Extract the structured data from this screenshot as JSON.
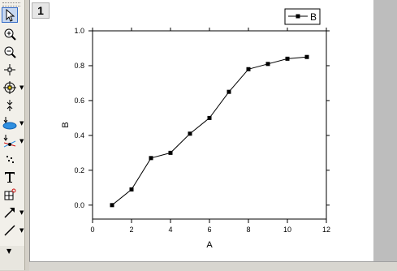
{
  "toolbar": {
    "tools": [
      {
        "name": "pointer-tool",
        "icon": "cursor-arrow-icon"
      },
      {
        "name": "zoom-in-tool",
        "icon": "zoom-in-icon"
      },
      {
        "name": "zoom-out-tool",
        "icon": "zoom-out-icon"
      },
      {
        "name": "screen-reader-tool",
        "icon": "crosshair-icon"
      },
      {
        "name": "data-reader-tool",
        "icon": "target-icon"
      },
      {
        "name": "data-selector-tool",
        "icon": "data-selector-icon"
      },
      {
        "name": "draw-data-tool",
        "icon": "draw-data-icon"
      },
      {
        "name": "mask-points-tool",
        "icon": "mask-points-icon"
      },
      {
        "name": "region-selector-tool",
        "icon": "scatter-dots-icon"
      },
      {
        "name": "text-tool",
        "icon": "text-T-icon"
      },
      {
        "name": "add-object-tool",
        "icon": "grid-plus-icon"
      },
      {
        "name": "arrow-tool",
        "icon": "arrow-icon"
      },
      {
        "name": "line-tool",
        "icon": "line-icon"
      }
    ]
  },
  "window": {
    "page_number": "1"
  },
  "chart_data": {
    "type": "line",
    "xlabel": "A",
    "ylabel": "B",
    "xlim": [
      0,
      12
    ],
    "ylim": [
      -0.08,
      1.0
    ],
    "xticks": [
      "0",
      "2",
      "4",
      "6",
      "8",
      "10",
      "12"
    ],
    "yticks": [
      "0.0",
      "0.2",
      "0.4",
      "0.6",
      "0.8",
      "1.0"
    ],
    "legend_position": "top-right",
    "series": [
      {
        "name": "B",
        "marker": "square",
        "color": "#000000",
        "x": [
          1,
          2,
          3,
          4,
          5,
          6,
          7,
          8,
          9,
          10,
          11
        ],
        "y": [
          0.0,
          0.09,
          0.27,
          0.3,
          0.41,
          0.5,
          0.65,
          0.78,
          0.81,
          0.84,
          0.85
        ]
      }
    ]
  }
}
